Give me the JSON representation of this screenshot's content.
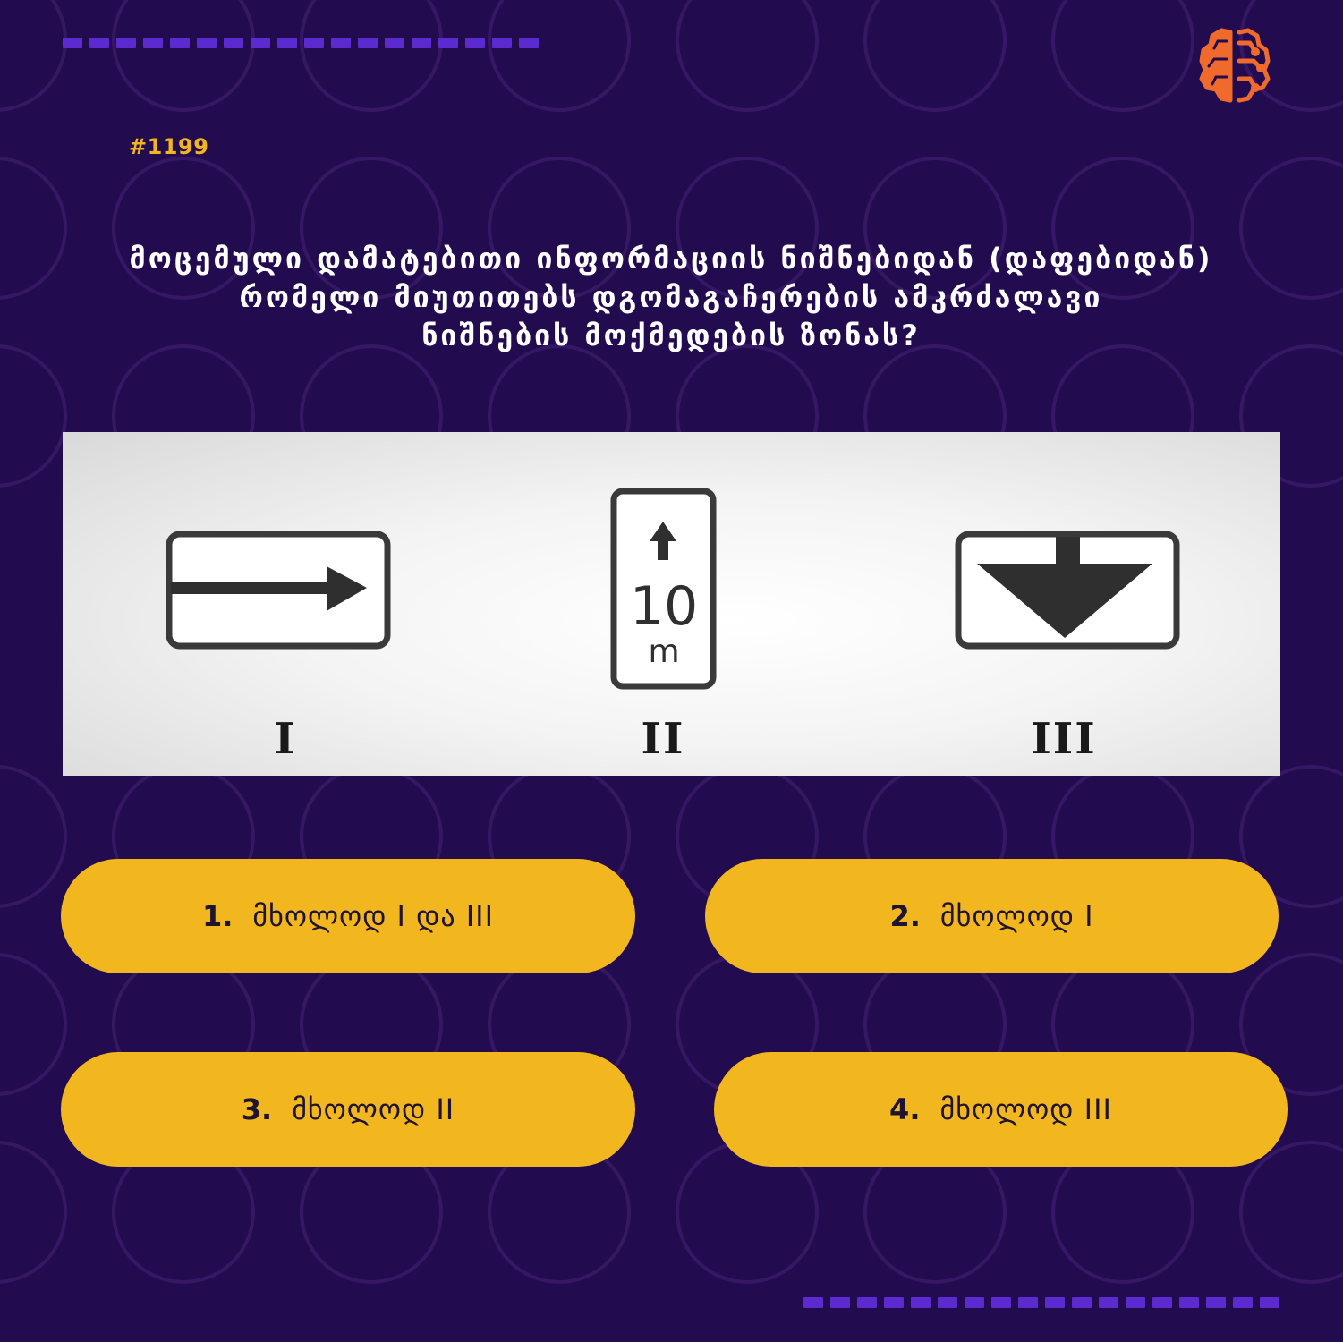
{
  "question_id": "#1199",
  "question": {
    "line1": "მოცემული დამატებითი ინფორმაციის ნიშნებიდან (დაფებიდან)",
    "line2": "რომელი მიუთითებს დგომაგაჩერების ამკრძალავი",
    "line3": "ნიშნების მოქმედების ზონას?"
  },
  "signs": [
    {
      "label": "I",
      "icon": "right-arrow-plate-icon"
    },
    {
      "label": "II",
      "icon": "distance-plate-icon",
      "value": "10",
      "unit": "m"
    },
    {
      "label": "III",
      "icon": "down-arrow-plate-icon"
    }
  ],
  "answers": [
    {
      "number": "1.",
      "text": "მხოლოდ I და III"
    },
    {
      "number": "2.",
      "text": "მხოლოდ I"
    },
    {
      "number": "3.",
      "text": "მხოლოდ II"
    },
    {
      "number": "4.",
      "text": "მხოლოდ III"
    }
  ],
  "colors": {
    "background": "#220b4f",
    "accent": "#f2b71e",
    "dash": "#5b2bcf",
    "logo": "#ef6a2b"
  }
}
